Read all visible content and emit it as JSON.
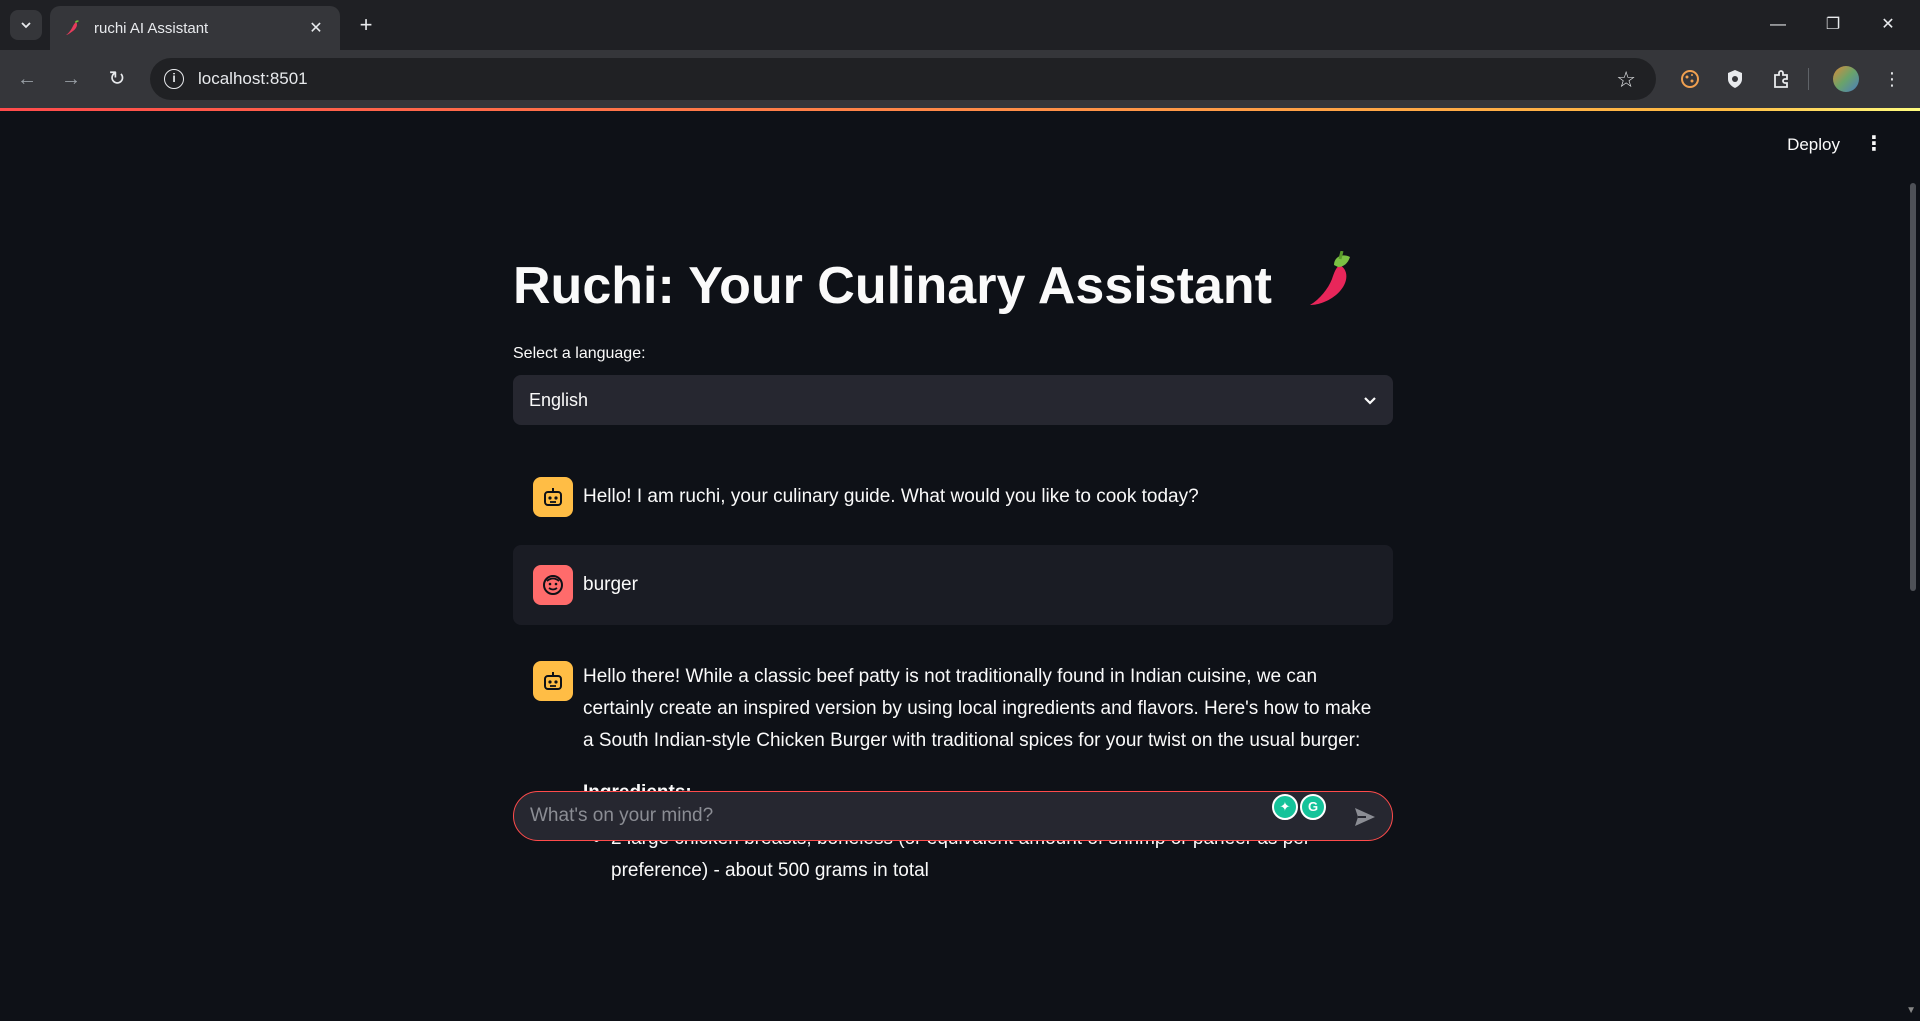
{
  "browser": {
    "tab_title": "ruchi AI Assistant",
    "url": "localhost:8501"
  },
  "app": {
    "deploy_label": "Deploy",
    "title": "Ruchi: Your Culinary Assistant",
    "language_label": "Select a language:",
    "language_value": "English",
    "chat_placeholder": "What's on your mind?"
  },
  "messages": [
    {
      "role": "assistant",
      "text": "Hello! I am ruchi, your culinary guide. What would you like to cook today?"
    },
    {
      "role": "user",
      "text": "burger"
    },
    {
      "role": "assistant",
      "intro": "Hello there! While a classic beef patty is not traditionally found in Indian cuisine, we can certainly create an inspired version by using local ingredients and flavors. Here's how to make a South Indian-style Chicken Burger with traditional spices for your twist on the usual burger:",
      "heading": "Ingredients:",
      "items": [
        "2 large chicken breasts, boneless (or equivalent amount of shrimp or paneer as per preference) - about 500 grams in total"
      ]
    }
  ],
  "colors": {
    "accent": "#ff4b4b",
    "assistant_avatar": "#ffbd45",
    "user_avatar": "#ff6b6b",
    "background": "#0e1117",
    "surface": "#262730"
  }
}
